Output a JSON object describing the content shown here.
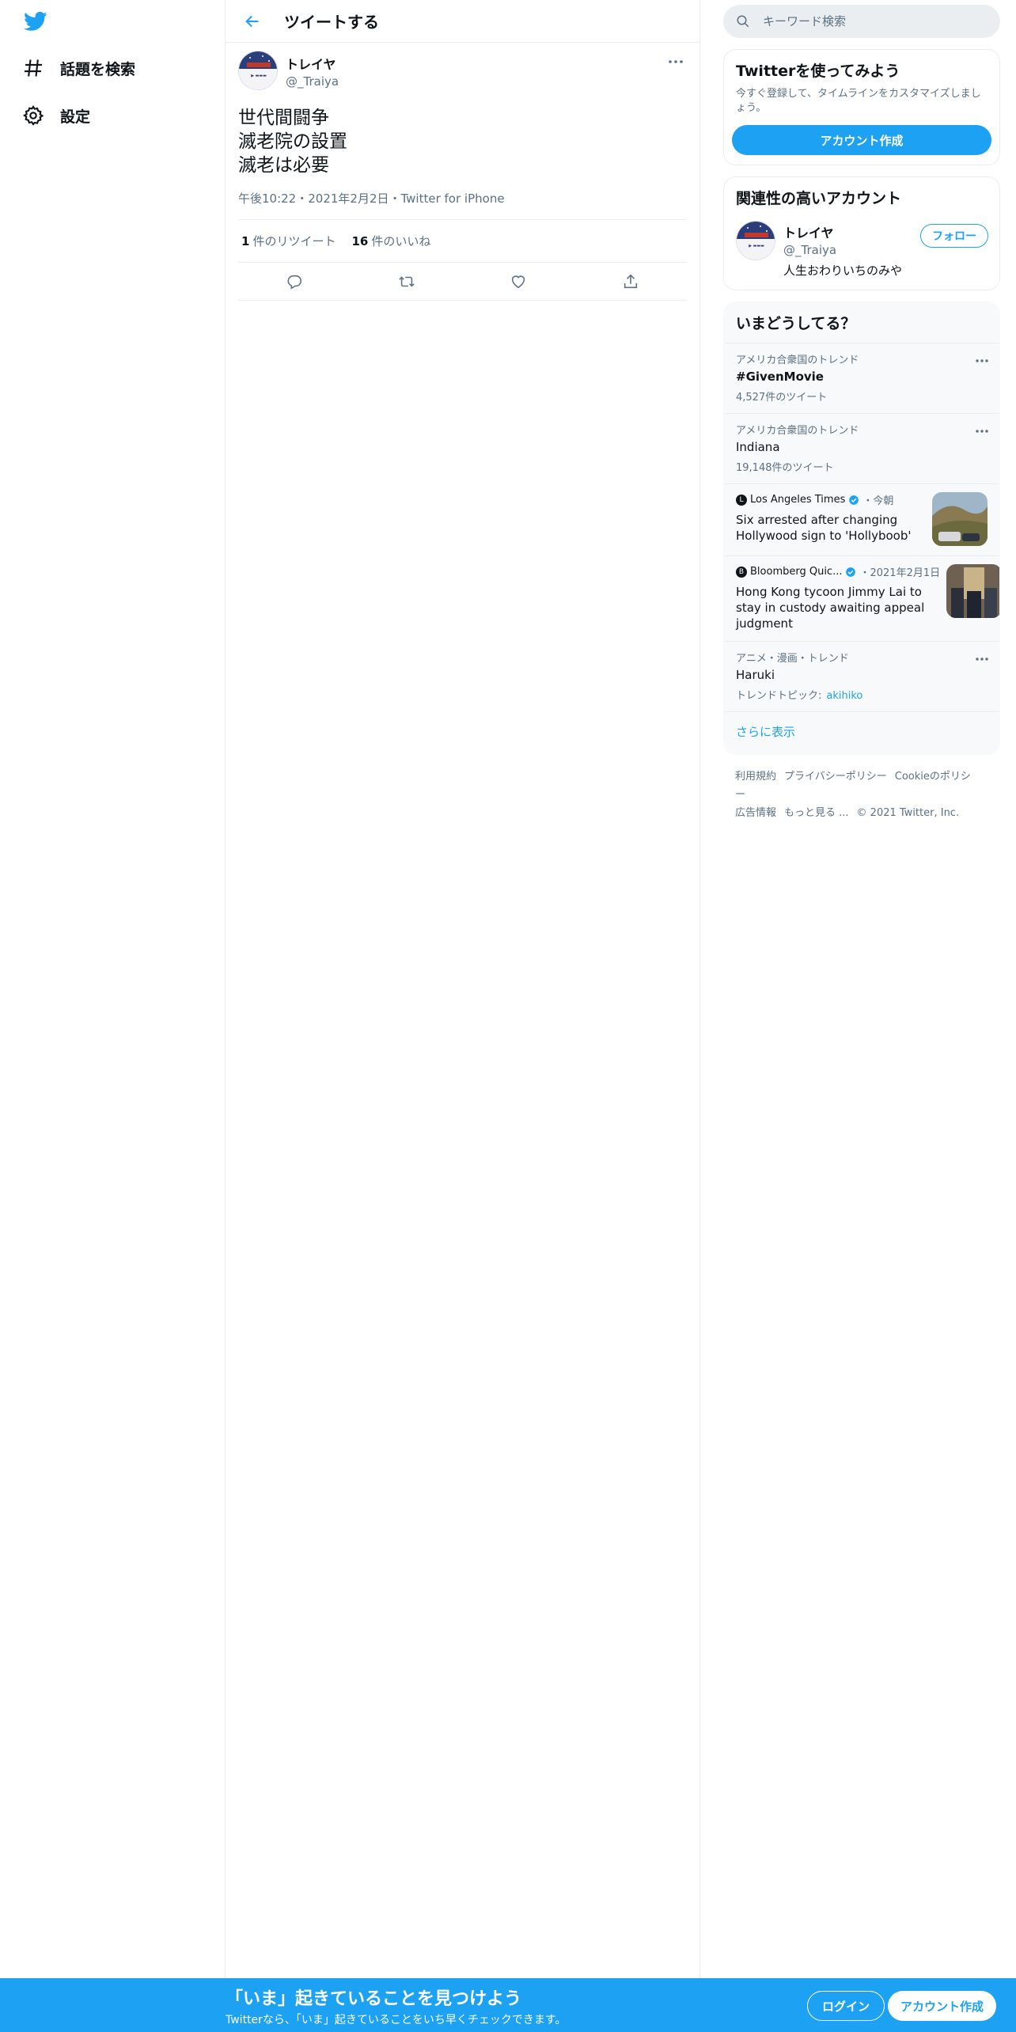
{
  "nav": {
    "items": [
      {
        "label": "話題を検索",
        "icon": "hashtag-icon"
      },
      {
        "label": "設定",
        "icon": "gear-icon"
      }
    ]
  },
  "main": {
    "header_title": "ツイートする",
    "tweet": {
      "author_name": "トレイヤ",
      "author_handle": "@_Traiya",
      "text": "世代間闘争\n滅老院の設置\n滅老は必要",
      "meta": "午後10:22・2021年2月2日・Twitter for iPhone",
      "retweets_count": "1",
      "retweets_label": "件のリツイート",
      "likes_count": "16",
      "likes_label": "件のいいね"
    }
  },
  "sidebar": {
    "search_placeholder": "キーワード検索",
    "signup_card": {
      "title": "Twitterを使ってみよう",
      "desc": "今すぐ登録して、タイムラインをカスタマイズしましょう。",
      "button": "アカウント作成"
    },
    "relevant": {
      "title": "関連性の高いアカウント",
      "name": "トレイヤ",
      "handle": "@_Traiya",
      "bio": "人生おわりいちのみや",
      "follow": "フォロー"
    },
    "trends": {
      "title": "いまどうしてる？",
      "items": [
        {
          "context": "アメリカ合衆国のトレンド",
          "name": "#GivenMovie",
          "count": "4,527件のツイート"
        },
        {
          "context": "アメリカ合衆国のトレンド",
          "name": "Indiana",
          "count": "19,148件のツイート"
        }
      ],
      "news": [
        {
          "source": "Los Angeles Times",
          "time": "・今朝",
          "title": "Six arrested after changing Hollywood sign to 'Hollyboob'"
        },
        {
          "source": "Bloomberg Quic...",
          "time": "・2021年2月1日",
          "title": "Hong Kong tycoon Jimmy Lai to stay in custody awaiting appeal judgment"
        }
      ],
      "topic_trend": {
        "context": "アニメ・漫画・トレンド",
        "name": "Haruki",
        "topic_label": "トレンドトピック:",
        "topic_link": "akihiko"
      },
      "show_more": "さらに表示"
    },
    "footer": {
      "links": [
        "利用規約",
        "プライバシーポリシー",
        "Cookieのポリシー",
        "広告情報",
        "もっと見る ..."
      ],
      "copyright": "© 2021 Twitter, Inc."
    }
  },
  "banner": {
    "title": "「いま」起きていることを見つけよう",
    "subtitle": "Twitterなら、「いま」起きていることをいち早くチェックできます。",
    "login": "ログイン",
    "signup": "アカウント作成"
  },
  "colors": {
    "accent": "#1da1f2",
    "text": "#0f1419",
    "secondary": "#5b7083",
    "border": "#ebeef0"
  }
}
